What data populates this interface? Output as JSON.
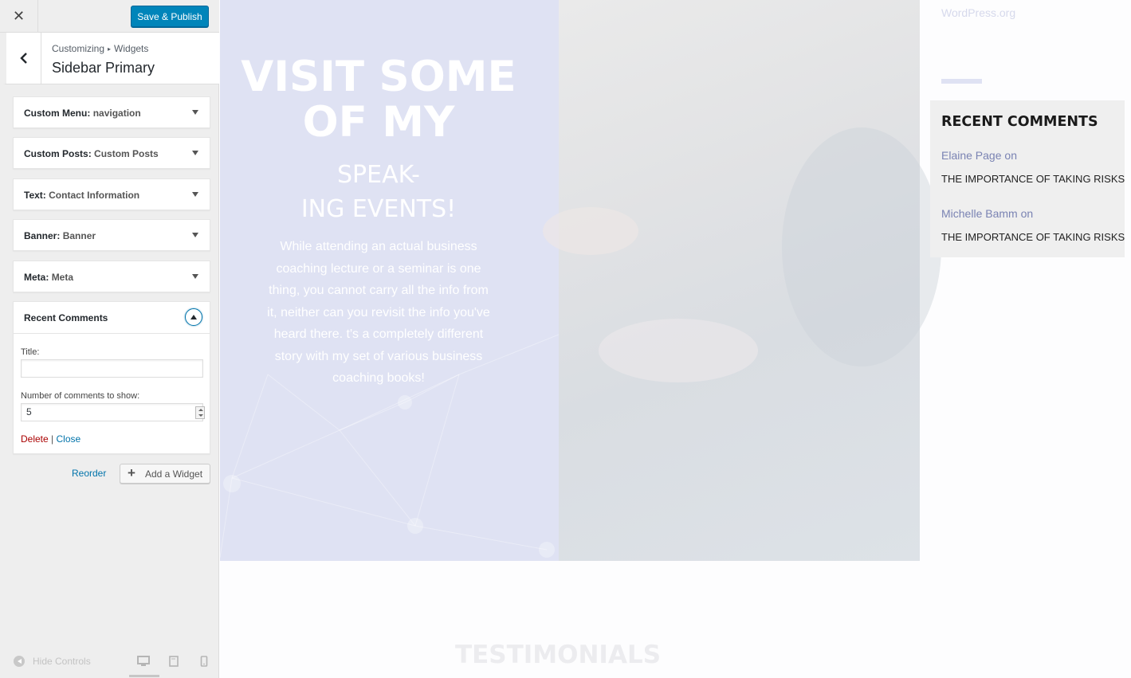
{
  "panel": {
    "close_icon": "close-icon",
    "save_label": "Save & Publish",
    "breadcrumb": {
      "parent": "Customizing",
      "separator": "▸",
      "current": "Widgets"
    },
    "section_title": "Sidebar Primary",
    "widgets": [
      {
        "type": "Custom Menu",
        "sep": ": ",
        "name": "navigation"
      },
      {
        "type": "Custom Posts",
        "sep": ": ",
        "name": "Custom Posts"
      },
      {
        "type": "Text",
        "sep": ": ",
        "name": "Contact Information"
      },
      {
        "type": "Banner",
        "sep": ": ",
        "name": "Banner"
      },
      {
        "type": "Meta",
        "sep": ": ",
        "name": "Meta"
      }
    ],
    "open_widget": {
      "title": "Recent Comments",
      "title_label": "Title:",
      "title_value": "",
      "count_label": "Number of comments to show:",
      "count_value": "5",
      "delete_label": "Delete",
      "pipe": " | ",
      "close_label": "Close"
    },
    "reorder_label": "Reorder",
    "add_widget_label": "Add a Widget",
    "footer": {
      "hide_controls_label": "Hide Controls"
    }
  },
  "preview": {
    "hero_title": "VISIT SOME OF MY",
    "hero_subtitle_line1": "SPEAK-",
    "hero_subtitle_line2": "ING EVENTS!",
    "hero_text": "While attending an actual business coaching lecture or a seminar is one thing, you cannot carry all the info from it, neither can you revisit the info you've heard there. t's a completely different story with my set of various business coaching books!",
    "testimonials_heading": "TESTIMONIALS",
    "sidebar": {
      "link_text": "WordPress.org",
      "recent_comments_heading": "RECENT COMMENTS",
      "comments": [
        {
          "author": "Elaine Page",
          "on": " on",
          "post": "THE IMPORTANCE OF TAKING RISKS"
        },
        {
          "author": "Michelle Bamm",
          "on": " on",
          "post": "THE IMPORTANCE OF TAKING RISKS"
        }
      ]
    }
  },
  "colors": {
    "primary_button": "#0085ba",
    "link": "#0073aa",
    "delete": "#aa0000",
    "hero_overlay": "#dfe2f3",
    "comment_author": "#7a83b3"
  }
}
